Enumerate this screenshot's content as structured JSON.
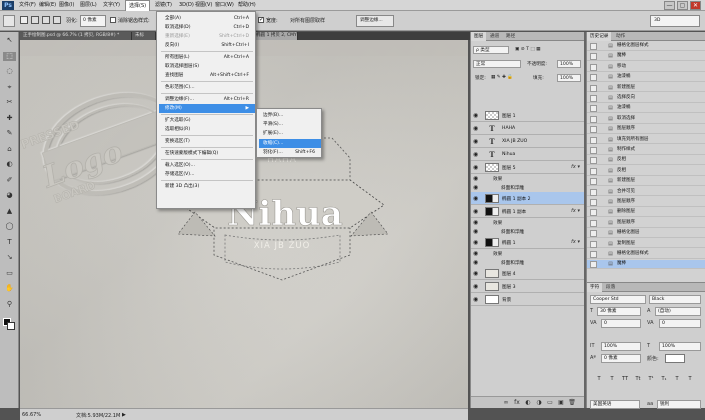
{
  "app": {
    "logo": "Ps"
  },
  "menubar": {
    "items": [
      "文件(F)",
      "编辑(E)",
      "图像(I)",
      "图层(L)",
      "文字(Y)",
      "选择(S)",
      "滤镜(T)",
      "3D(D)",
      "视图(V)",
      "窗口(W)",
      "帮助(H)"
    ],
    "active_index": 5,
    "minimize": "—",
    "maximize": "▢",
    "close": "✕"
  },
  "options": {
    "feather_label": "羽化:",
    "feather_value": "0 像素",
    "antialias_label": "消除锯齿",
    "style_label": "样式:",
    "style_value": "正常",
    "width_label": "宽度:",
    "height_label": "高度:",
    "refine_button": "调整边缘...",
    "workspace": "3D",
    "checkbox_label": "对所有图层取样"
  },
  "tabs": [
    {
      "label": "正手绘制图.psd @ 66.7% (1 拷贝, RGB/8#) *",
      "active": false
    },
    {
      "label": "未标题-1 @ 100% (图层 1, RGB/8#) *",
      "active": false
    },
    {
      "label": "... @ 66.7% (椭圆 1 拷贝 2, CMYK/8) * ×",
      "active": true
    }
  ],
  "toolbox": {
    "tools": [
      "↖",
      "⬚",
      "◌",
      "⌖",
      "✂",
      "✚",
      "✎",
      "⌂",
      "◐",
      "✐",
      "◕",
      "▲",
      "◯",
      "T",
      "↘",
      "▭",
      "✋",
      "⚲"
    ],
    "selected_index": 1
  },
  "canvas": {
    "stamp_top": "PRESSED",
    "stamp_middle": "Logo",
    "stamp_bottom": "BOARD",
    "ribbon_title": "Nihua",
    "ribbon_top": "HAHA",
    "ribbon_bottom": "XIA JB ZUO"
  },
  "statusbar": {
    "zoom": "66.67%",
    "doc": "文档:5.93M/22.1M",
    "arrow": "▶"
  },
  "select_menu": {
    "items": [
      {
        "label": "全部(A)",
        "shortcut": "Ctrl+A",
        "disabled": false
      },
      {
        "label": "取消选择(D)",
        "shortcut": "Ctrl+D",
        "disabled": false
      },
      {
        "label": "重新选择(E)",
        "shortcut": "Shift+Ctrl+D",
        "disabled": true
      },
      {
        "label": "反向(I)",
        "shortcut": "Shift+Ctrl+I",
        "disabled": false
      },
      {
        "sep": true
      },
      {
        "label": "所有图层(L)",
        "shortcut": "Alt+Ctrl+A",
        "disabled": false
      },
      {
        "label": "取消选择图层(S)",
        "shortcut": "",
        "disabled": false
      },
      {
        "label": "查找图层",
        "shortcut": "Alt+Shift+Ctrl+F",
        "disabled": false
      },
      {
        "sep": true
      },
      {
        "label": "色彩范围(C)...",
        "shortcut": "",
        "disabled": false
      },
      {
        "sep": true
      },
      {
        "label": "调整边缘(F)...",
        "shortcut": "Alt+Ctrl+R",
        "disabled": false
      },
      {
        "label": "修改(M)",
        "shortcut": "▶",
        "disabled": false,
        "highlighted": true
      },
      {
        "sep": true
      },
      {
        "label": "扩大选取(G)",
        "shortcut": "",
        "disabled": false
      },
      {
        "label": "选取相似(R)",
        "shortcut": "",
        "disabled": false
      },
      {
        "sep": true
      },
      {
        "label": "变换选区(T)",
        "shortcut": "",
        "disabled": false
      },
      {
        "sep": true
      },
      {
        "label": "在快速蒙版模式下编辑(Q)",
        "shortcut": "",
        "disabled": false
      },
      {
        "sep": true
      },
      {
        "label": "载入选区(O)...",
        "shortcut": "",
        "disabled": false
      },
      {
        "label": "存储选区(V)...",
        "shortcut": "",
        "disabled": false
      },
      {
        "sep": true
      },
      {
        "label": "新建 3D 凸出(3)",
        "shortcut": "",
        "disabled": false
      }
    ]
  },
  "modify_submenu": {
    "items": [
      {
        "label": "边界(B)...",
        "shortcut": ""
      },
      {
        "label": "平滑(S)...",
        "shortcut": ""
      },
      {
        "label": "扩展(E)...",
        "shortcut": ""
      },
      {
        "label": "收缩(C)...",
        "shortcut": "",
        "highlighted": true
      },
      {
        "label": "羽化(F)...",
        "shortcut": "Shift+F6"
      }
    ]
  },
  "layers_panel": {
    "tabs": [
      "图层",
      "通道",
      "路径"
    ],
    "filter": "ρ 类型",
    "blend_mode": "正常",
    "opacity_label": "不透明度:",
    "opacity_value": "100%",
    "lock_label": "锁定:",
    "fill_label": "填充:",
    "fill_value": "100%",
    "layers": [
      {
        "name": "图层 1",
        "kind": "checker",
        "fx": false
      },
      {
        "name": "HAHA",
        "kind": "text",
        "fx": false
      },
      {
        "name": "XIA JB ZUO",
        "kind": "text",
        "fx": false
      },
      {
        "name": "Nihua",
        "kind": "text",
        "fx": false
      },
      {
        "name": "图层 5",
        "kind": "checker",
        "fx": true
      },
      {
        "name": "效果",
        "kind": "sub",
        "fx": false
      },
      {
        "name": "斜面和浮雕",
        "kind": "sub2",
        "fx": false
      },
      {
        "name": "椭圆 1 副本 2",
        "kind": "dark",
        "fx": false,
        "selected": true
      },
      {
        "name": "椭圆 1 副本",
        "kind": "dark",
        "fx": true
      },
      {
        "name": "效果",
        "kind": "sub",
        "fx": false
      },
      {
        "name": "斜面和浮雕",
        "kind": "sub2",
        "fx": false
      },
      {
        "name": "椭圆 1",
        "kind": "dark",
        "fx": true
      },
      {
        "name": "效果",
        "kind": "sub",
        "fx": false
      },
      {
        "name": "斜面和浮雕",
        "kind": "sub2",
        "fx": false
      },
      {
        "name": "图层 4",
        "kind": "plain",
        "fx": false
      },
      {
        "name": "图层 3",
        "kind": "plain",
        "fx": false
      },
      {
        "name": "背景",
        "kind": "white",
        "fx": false
      }
    ],
    "bottom_icons": [
      "∞",
      "fx",
      "◐",
      "◑",
      "▭",
      "▣",
      "🗑"
    ]
  },
  "history_panel": {
    "tabs": [
      "历史记录",
      "动作"
    ],
    "items": [
      "栅格化图层样式",
      "魔棒",
      "移动",
      "油漆桶",
      "新建图层",
      "选择反向",
      "油漆桶",
      "取消选择",
      "图层顺序",
      "填充到所有图层",
      "制作样式",
      "反相",
      "反相",
      "新建图层",
      "合并可见",
      "图层顺序",
      "删除图层",
      "图层顺序",
      "栅格化图层",
      "复制图层",
      "栅格化图层样式",
      "魔棒"
    ],
    "selected_index": 21
  },
  "char_panel": {
    "tabs": [
      "字符",
      "段落"
    ],
    "font": "Cooper Std",
    "style": "Black",
    "size": "30 像素",
    "leading": "(自动)",
    "kerning": "0",
    "tracking": "0",
    "scale": "100%",
    "vscale": "100%",
    "baseline": "0 像素",
    "color_label": "颜色:",
    "tt_buttons": [
      "T",
      "T",
      "TT",
      "Tt",
      "T¹",
      "T₁",
      "T",
      "T"
    ],
    "language": "美国英语",
    "aa": "aa",
    "aa_mode": "锐利"
  }
}
